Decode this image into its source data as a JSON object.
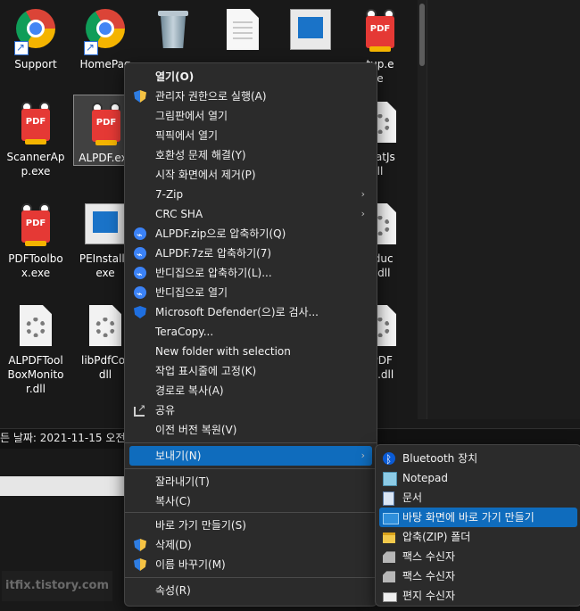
{
  "desktop": {
    "icons": [
      {
        "label": "Support",
        "type": "chrome"
      },
      {
        "label": "HomePag",
        "type": "chrome"
      },
      {
        "label": "",
        "type": "recycle-bin"
      },
      {
        "label": "",
        "type": "blank-doc"
      },
      {
        "label": "",
        "type": "installer"
      },
      {
        "label": "tup.e\ne",
        "type": "pdf"
      },
      {
        "label": "ScannerAp\np.exe",
        "type": "pdf"
      },
      {
        "label": "ALPDF.exe",
        "type": "pdf"
      },
      {
        "label": "matJs\nll",
        "type": "gear-doc"
      },
      {
        "label": "PDFToolbo\nx.exe",
        "type": "pdf"
      },
      {
        "label": "PEInstalle\nexe",
        "type": "installer"
      },
      {
        "label": "oduc\nt.dll",
        "type": "gear-doc"
      },
      {
        "label": "ALPDFTool\nBoxMonito\nr.dll",
        "type": "gear-doc"
      },
      {
        "label": "libPdfCor\ndll",
        "type": "gear-doc"
      },
      {
        "label": "-PDF\nnt.dll",
        "type": "gear-doc"
      }
    ],
    "details_bar": "든 날짜:   2021-11-15 오전",
    "watermark": "itfix.tistory.com"
  },
  "context_menu": {
    "items": [
      {
        "label": "열기(O)",
        "icon": "",
        "bold": true
      },
      {
        "label": "관리자 권한으로 실행(A)",
        "icon": "uac-shield-icon"
      },
      {
        "label": "그림판에서 열기",
        "icon": ""
      },
      {
        "label": "픽픽에서 열기",
        "icon": ""
      },
      {
        "label": "호환성 문제 해결(Y)",
        "icon": ""
      },
      {
        "label": "시작 화면에서 제거(P)",
        "icon": ""
      },
      {
        "label": "7-Zip",
        "icon": "",
        "submenu": true
      },
      {
        "label": "CRC SHA",
        "icon": "",
        "submenu": true
      },
      {
        "label": "ALPDF.zip으로 압축하기(Q)",
        "icon": "bandizip-icon"
      },
      {
        "label": "ALPDF.7z로 압축하기(7)",
        "icon": "bandizip-icon"
      },
      {
        "label": "반디집으로 압축하기(L)...",
        "icon": "bandizip-icon"
      },
      {
        "label": "반디집으로 열기",
        "icon": "bandizip-icon"
      },
      {
        "label": "Microsoft Defender(으)로 검사...",
        "icon": "defender-icon"
      },
      {
        "label": "TeraCopy...",
        "icon": ""
      },
      {
        "label": "New folder with selection",
        "icon": ""
      },
      {
        "label": "작업 표시줄에 고정(K)",
        "icon": ""
      },
      {
        "label": "경로로 복사(A)",
        "icon": ""
      },
      {
        "label": "공유",
        "icon": "share-icon"
      },
      {
        "label": "이전 버전 복원(V)",
        "icon": ""
      },
      {
        "label": "보내기(N)",
        "icon": "",
        "submenu": true,
        "active": true
      },
      {
        "label": "잘라내기(T)",
        "icon": ""
      },
      {
        "label": "복사(C)",
        "icon": ""
      },
      {
        "label": "바로 가기 만들기(S)",
        "icon": ""
      },
      {
        "label": "삭제(D)",
        "icon": "uac-shield-icon"
      },
      {
        "label": "이름 바꾸기(M)",
        "icon": "uac-shield-icon"
      },
      {
        "label": "속성(R)",
        "icon": ""
      }
    ],
    "submenu_arrow": "›"
  },
  "send_to_menu": {
    "items": [
      {
        "label": "Bluetooth 장치",
        "icon": "bluetooth-icon"
      },
      {
        "label": "Notepad",
        "icon": "notepad-icon"
      },
      {
        "label": "문서",
        "icon": "documents-icon"
      },
      {
        "label": "바탕 화면에 바로 가기 만들기",
        "icon": "desktop-icon",
        "active": true
      },
      {
        "label": "압축(ZIP) 폴더",
        "icon": "zip-folder-icon"
      },
      {
        "label": "팩스 수신자",
        "icon": "fax-icon"
      },
      {
        "label": "팩스 수신자",
        "icon": "fax-icon"
      },
      {
        "label": "편지 수신자",
        "icon": "mail-icon"
      }
    ]
  }
}
